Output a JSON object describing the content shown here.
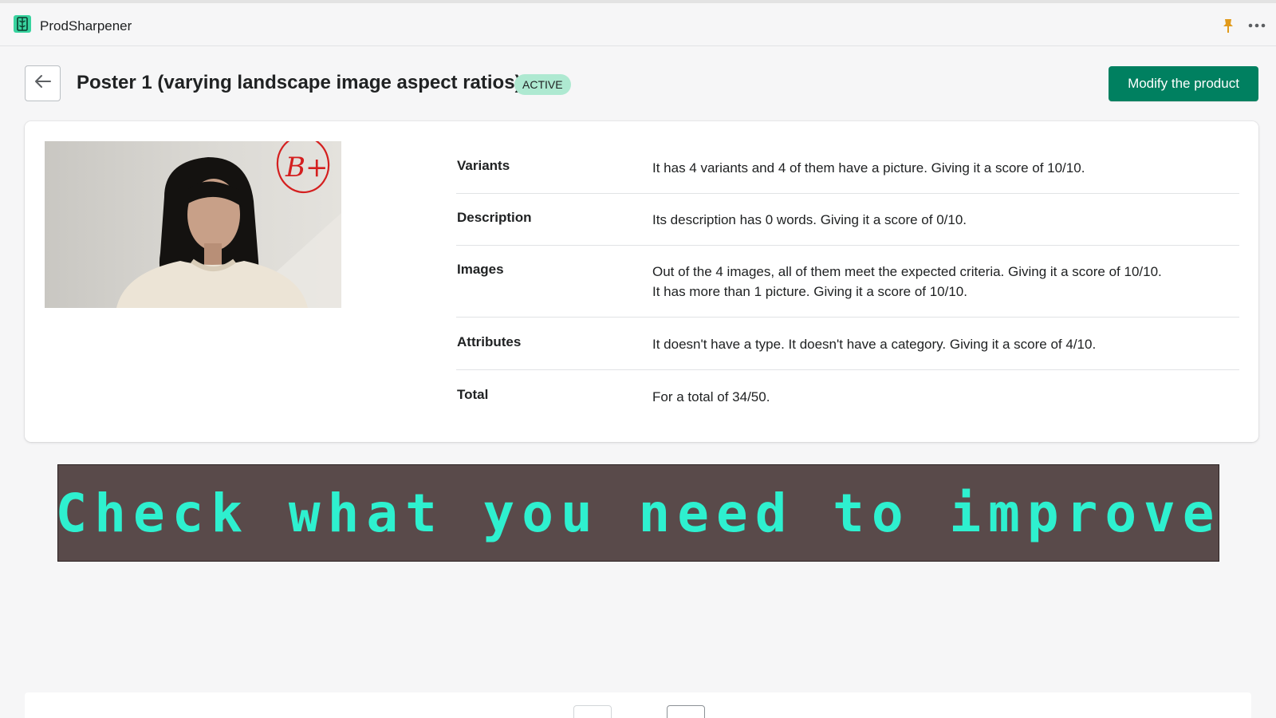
{
  "app": {
    "name": "ProdSharpener",
    "logo_icon": "book-icon",
    "accent_color": "#38d39f"
  },
  "topbar": {
    "pin_icon": "pin-icon",
    "more_icon": "more-horizontal-icon"
  },
  "header": {
    "back_icon": "arrow-left-icon",
    "title": "Poster 1 (varying landscape image aspect ratios)",
    "status": "ACTIVE",
    "primary_action": "Modify the product",
    "primary_color": "#008060",
    "badge_color": "#aee9d1"
  },
  "product": {
    "image_alt": "Portrait photo of a woman in a cream sweater",
    "grade": "B+"
  },
  "score_rows": [
    {
      "label": "Variants",
      "value": "It has 4 variants and 4 of them have a picture. Giving it a score of 10/10."
    },
    {
      "label": "Description",
      "value": "Its description has 0 words. Giving it a score of 0/10."
    },
    {
      "label": "Images",
      "value": "Out of the 4 images, all of them meet the expected criteria. Giving it a score of 10/10.",
      "value2": "It has more than 1 picture. Giving it a score of 10/10."
    },
    {
      "label": "Attributes",
      "value": "It doesn't have a type. It doesn't have a category. Giving it a score of 4/10."
    },
    {
      "label": "Total",
      "value": "For a total of 34/50."
    }
  ],
  "banner": {
    "text": "Check what you need to improve",
    "background": "#594a4a",
    "text_color": "#2ef0cf"
  },
  "pagination": {
    "prev_icon": "chevron-left-icon",
    "next_icon": "chevron-right-icon"
  }
}
